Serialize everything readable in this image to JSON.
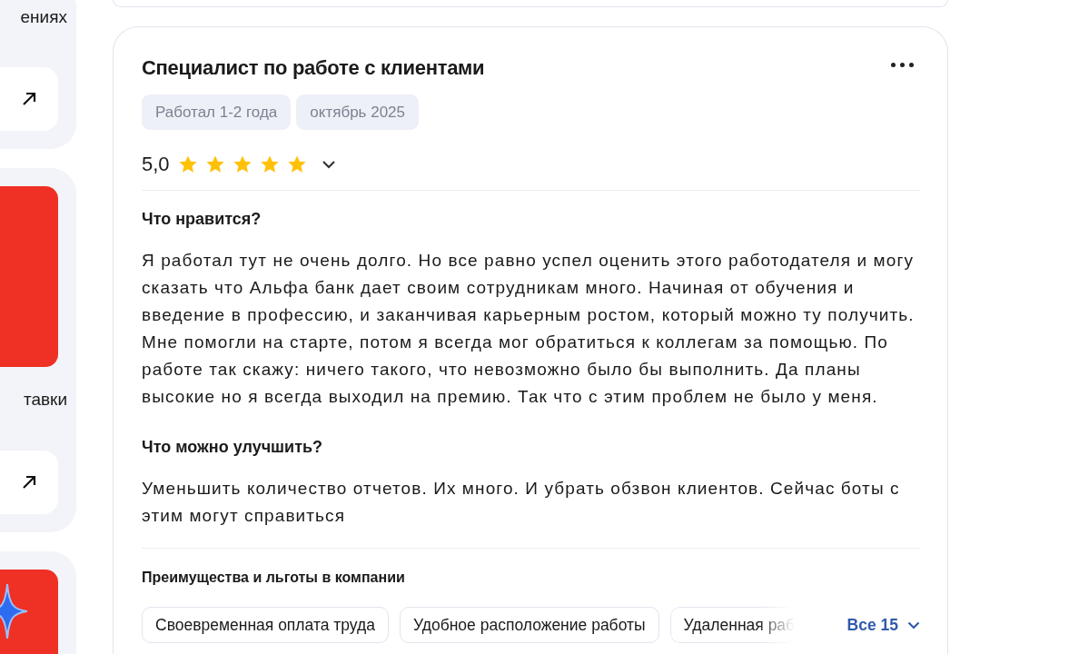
{
  "side_panel": {
    "cards": [
      {
        "kind": "link",
        "caption": "ениях"
      },
      {
        "kind": "promo",
        "caption": "тавки"
      },
      {
        "kind": "promo_star"
      }
    ]
  },
  "review": {
    "title": "Специалист по работе с клиентами",
    "tags": [
      "Работал 1-2 года",
      "октябрь 2025"
    ],
    "rating": "5,0",
    "stars": 5,
    "sections": [
      {
        "heading": "Что нравится?",
        "text": "Я работал тут не очень долго. Но все равно успел оценить этого работодателя и могу сказать что Альфа банк дает своим сотрудникам много. Начиная от обучения и введение в профессию, и заканчивая карьерным ростом, который можно ту получить. Мне помогли на старте, потом я всегда мог обратиться к коллегам за помощью. По работе так скажу: ничего такого, что невозможно было бы выполнить. Да планы высокие но я всегда выходил на премию. Так что с этим проблем не было у меня."
      },
      {
        "heading": "Что можно улучшить?",
        "text": "Уменьшить количество отчетов. Их много. И убрать обзвон клиентов. Сейчас боты с этим могут справиться"
      }
    ],
    "benefits": {
      "heading": "Преимущества и льготы в компании",
      "items": [
        "Своевременная оплата труда",
        "Удобное расположение работы",
        "Удаленная раб"
      ],
      "more": "Все 15"
    }
  }
}
